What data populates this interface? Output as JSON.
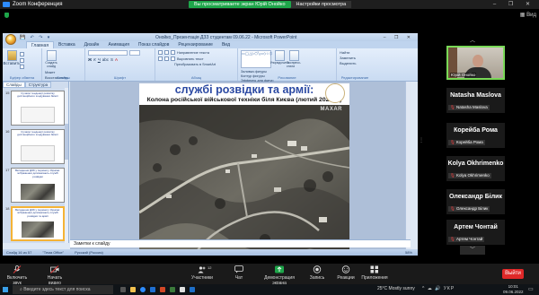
{
  "zoom": {
    "title": "Zoom Конференция",
    "share_banner": "Вы просматриваете экран Юрій Онойко",
    "view_options": "Настройки просмотра",
    "view_button": "Вид",
    "controls": [
      {
        "label": "Включить звук",
        "icon": "mic-muted-icon"
      },
      {
        "label": "Начать видео",
        "icon": "video-off-icon"
      },
      {
        "label": "Участники",
        "icon": "participants-icon",
        "count": "12"
      },
      {
        "label": "Чат",
        "icon": "chat-icon"
      },
      {
        "label": "Демонстрация экрана",
        "icon": "share-screen-icon"
      },
      {
        "label": "Запись",
        "icon": "record-icon"
      },
      {
        "label": "Реакции",
        "icon": "reactions-icon"
      },
      {
        "label": "Приложения",
        "icon": "apps-icon"
      }
    ],
    "end_button": "Выйти",
    "end_color": "#e02828",
    "share_color": "#1ea64a"
  },
  "participants": {
    "self_video_name": "Юрій Онойко",
    "tiles": [
      {
        "big": "Natasha Maslova",
        "small": "Natasha Maslova"
      },
      {
        "big": "Корейба Рома",
        "small": "Корейба Рома"
      },
      {
        "big": "Kolya Okhrimenko",
        "small": "Kolya Okhrimenko"
      },
      {
        "big": "Олександр Білик",
        "small": "Олександр Білик"
      },
      {
        "big": "Артем Чонтай",
        "small": "Артем Чонтай"
      }
    ]
  },
  "ppt": {
    "title": "Онойко_Презентація ДЗЗ студентам 09.06.22 - Microsoft PowerPoint",
    "tabs": [
      "Главная",
      "Вставка",
      "Дизайн",
      "Анимация",
      "Показ слайдов",
      "Рецензирование",
      "Вид"
    ],
    "ribbon": {
      "create_slide": "Создать слайд",
      "paste": "Вставить",
      "layout": "Макет",
      "reset": "Восстановить",
      "delete": "Удалить",
      "groups": [
        "Буфер обмена",
        "Слайды",
        "Шрифт",
        "Абзац",
        "Рисование",
        "Редактирование"
      ],
      "text_direction": "Направление текста",
      "align_text": "Выровнять текст",
      "convert_smartart": "Преобразовать в SmartArt",
      "arrange": "Упорядочить",
      "express_styles": "Экспресс-стили",
      "shape_fill": "Заливка фигуры",
      "shape_outline": "Контур фигуры",
      "shape_effects": "Эффекты для фигур",
      "find": "Найти",
      "replace": "Заменить",
      "select": "Выделить"
    },
    "side_tabs": [
      "Слайды",
      "Структура"
    ],
    "thumbnails": [
      {
        "num": "15",
        "text": "Сучасні тенденції розвитку дистанційного зондування Землі"
      },
      {
        "num": "16",
        "text": "Сучасні тенденції розвитку дистанційного зондування Землі"
      },
      {
        "num": "17",
        "text": "Вкладення ДЗЗ у перемогу України: зображення допомагають службі розвідки"
      },
      {
        "num": "18",
        "text": "Вкладення ДЗЗ у перемогу України: зображення допомагають службі розвідки та армії"
      }
    ],
    "slide": {
      "heading": "службі розвідки та армії:",
      "subheading": "Колона російської військової техніки біля Києва (лютий 2022 р.)",
      "watermark": "MAXAR"
    },
    "notes_placeholder": "Заметки к слайду",
    "status": {
      "slide": "Слайд 16 из 57",
      "theme": "\"Тема Office\"",
      "language": "Русский (Россия)",
      "zoom": "58%"
    }
  },
  "taskbar": {
    "search_placeholder": "Введите здесь текст для поиска",
    "weather": "25°C  Mostly sunny",
    "language": "УКР",
    "time": "10:01",
    "date": "09.06.2022"
  }
}
